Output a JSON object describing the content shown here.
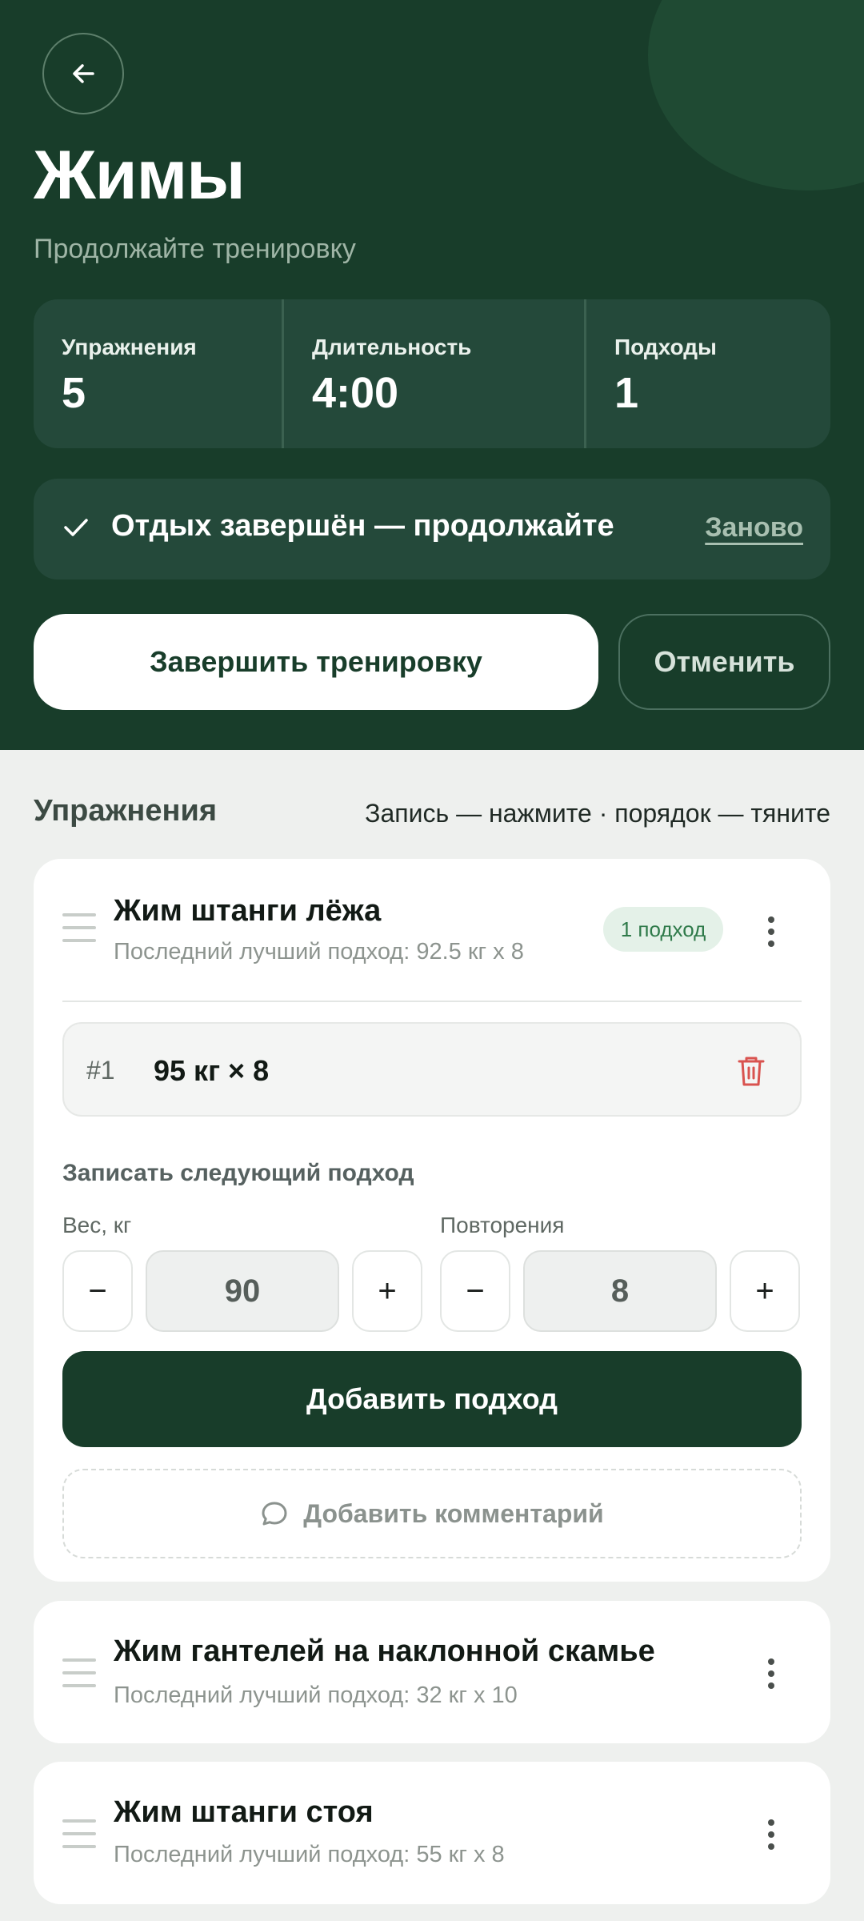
{
  "header": {
    "title": "Жимы",
    "subtitle": "Продолжайте тренировку",
    "back_icon": "arrow-left-icon"
  },
  "stats": [
    {
      "label": "Упражнения",
      "value": "5"
    },
    {
      "label": "Длительность",
      "value": "4:00"
    },
    {
      "label": "Подходы",
      "value": "1"
    }
  ],
  "rest": {
    "text": "Отдых завершён — продолжайте",
    "restart_label": "Заново"
  },
  "actions": {
    "finish_label": "Завершить тренировку",
    "cancel_label": "Отменить"
  },
  "exercises_section": {
    "title": "Упражнения",
    "hint": "Запись — нажмите · порядок — тяните"
  },
  "exercises": [
    {
      "name": "Жим штанги лёжа",
      "last_best": "Последний лучший подход: 92.5 кг x 8",
      "badge": "1 подход",
      "sets": [
        {
          "number": "#1",
          "value": "95 кг × 8"
        }
      ],
      "next_set_label": "Записать следующий подход",
      "weight_label": "Вес, кг",
      "weight_value": "90",
      "reps_label": "Повторения",
      "reps_value": "8",
      "minus_symbol": "−",
      "plus_symbol": "+",
      "add_set_label": "Добавить подход",
      "add_comment_label": "Добавить комментарий"
    },
    {
      "name": "Жим гантелей на наклонной скамье",
      "last_best": "Последний лучший подход: 32 кг x 10"
    },
    {
      "name": "Жим штанги стоя",
      "last_best": "Последний лучший подход: 55 кг x 8"
    }
  ],
  "colors": {
    "header_bg": "#183d2a",
    "accent": "#183d2a",
    "badge_bg": "#e4f1e8",
    "badge_text": "#2f7a4a",
    "delete": "#d9534f"
  }
}
